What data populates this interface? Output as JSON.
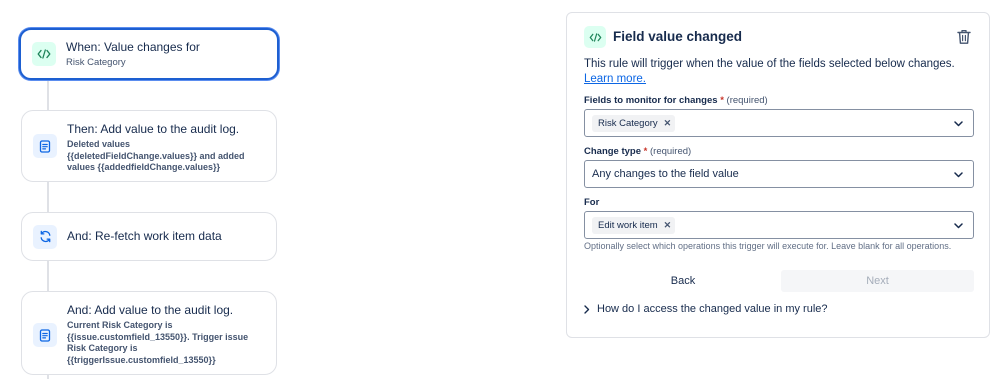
{
  "flow": {
    "trigger": {
      "title": "When: Value changes for",
      "subtitle": "Risk Category",
      "icon": "field-change-icon"
    },
    "actions": [
      {
        "title": "Then: Add value to the audit log.",
        "description": "Deleted values {{deletedFieldChange.values}} and added values {{addedfieldChange.values}}",
        "icon": "document-icon"
      },
      {
        "title": "And: Re-fetch work item data",
        "icon": "refresh-icon"
      },
      {
        "title": "And: Add value to the audit log.",
        "description": "Current Risk Category is {{issue.customfield_13550}}. Trigger issue Risk Category is {{triggerIssue.customfield_13550}}",
        "icon": "document-icon"
      }
    ]
  },
  "panel": {
    "title": "Field value changed",
    "intro": "This rule will trigger when the value of the fields selected below changes.",
    "learn_more": "Learn more.",
    "fields_label": "Fields to monitor for changes",
    "fields_required": "(required)",
    "fields_chip": "Risk Category",
    "change_type_label": "Change type",
    "change_type_required": "(required)",
    "change_type_value": "Any changes to the field value",
    "for_label": "For",
    "for_chip": "Edit work item",
    "for_help": "Optionally select which operations this trigger will execute for. Leave blank for all operations.",
    "back_label": "Back",
    "next_label": "Next",
    "accordion_label": "How do I access the changed value in my rule?"
  },
  "colors": {
    "accent": "#1d5fd1",
    "link": "#0c66e4",
    "required": "#c9372c",
    "trigger_icon_bg": "#dcfff1",
    "action_icon_bg": "#e9f2ff"
  }
}
